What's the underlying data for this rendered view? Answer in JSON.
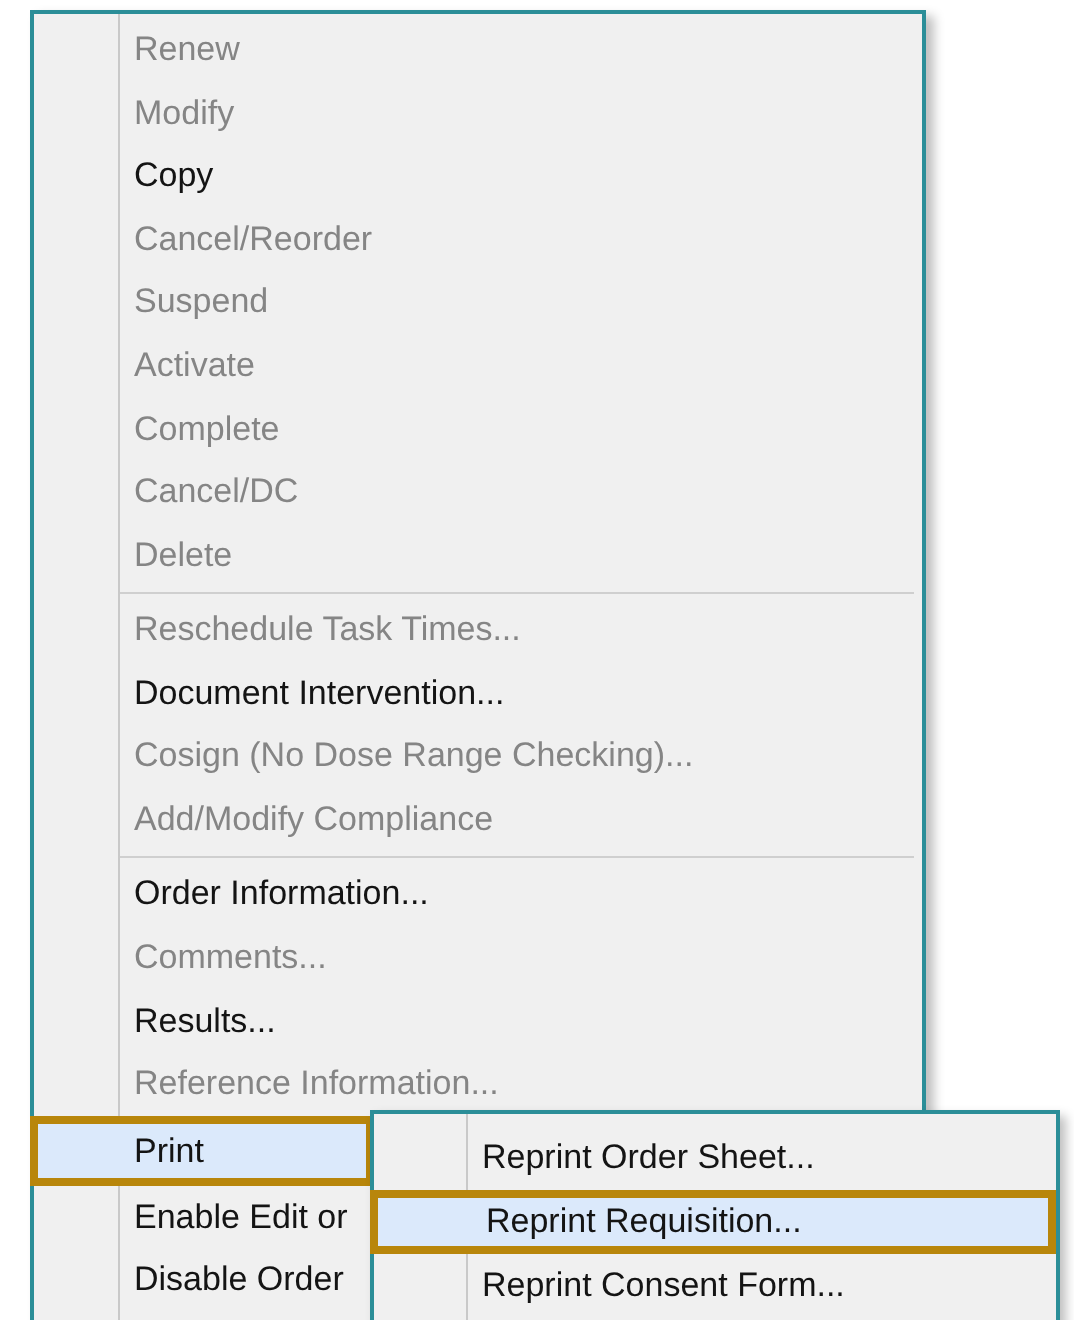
{
  "menu": {
    "groups": [
      {
        "items": [
          {
            "label": "Renew",
            "disabled": true,
            "selected": false
          },
          {
            "label": "Modify",
            "disabled": true,
            "selected": false
          },
          {
            "label": "Copy",
            "disabled": false,
            "selected": false
          },
          {
            "label": "Cancel/Reorder",
            "disabled": true,
            "selected": false
          },
          {
            "label": "Suspend",
            "disabled": true,
            "selected": false
          },
          {
            "label": "Activate",
            "disabled": true,
            "selected": false
          },
          {
            "label": "Complete",
            "disabled": true,
            "selected": false
          },
          {
            "label": "Cancel/DC",
            "disabled": true,
            "selected": false
          },
          {
            "label": "Delete",
            "disabled": true,
            "selected": false
          }
        ]
      },
      {
        "items": [
          {
            "label": "Reschedule Task Times...",
            "disabled": true,
            "selected": false
          },
          {
            "label": "Document Intervention...",
            "disabled": false,
            "selected": false
          },
          {
            "label": "Cosign (No Dose Range Checking)...",
            "disabled": true,
            "selected": false
          },
          {
            "label": "Add/Modify Compliance",
            "disabled": true,
            "selected": false
          }
        ]
      },
      {
        "items": [
          {
            "label": "Order Information...",
            "disabled": false,
            "selected": false
          },
          {
            "label": "Comments...",
            "disabled": true,
            "selected": false
          },
          {
            "label": "Results...",
            "disabled": false,
            "selected": false
          },
          {
            "label": "Reference Information...",
            "disabled": true,
            "selected": false
          },
          {
            "label": "Print",
            "disabled": false,
            "selected": true
          },
          {
            "label": "Enable Edit or",
            "disabled": false,
            "selected": false
          },
          {
            "label": "Disable Order",
            "disabled": false,
            "selected": false
          }
        ]
      }
    ]
  },
  "submenu": {
    "items": [
      {
        "label": "Reprint Order Sheet...",
        "disabled": false,
        "selected": false
      },
      {
        "label": "Reprint Requisition...",
        "disabled": false,
        "selected": true
      },
      {
        "label": "Reprint Consent Form...",
        "disabled": false,
        "selected": false
      }
    ]
  }
}
